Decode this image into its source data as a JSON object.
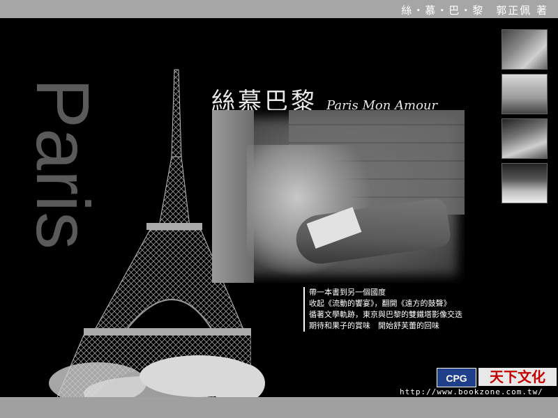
{
  "header": {
    "title": "絲・慕・巴・黎　郭正佩 著"
  },
  "side_word": "Paris",
  "heading": {
    "zh": "絲慕巴黎",
    "en": "Paris Mon Amour"
  },
  "caption": {
    "lines": [
      "帶一本書到另一個國度",
      "收起《流動的饗宴》，翻開《遠方的鼓聲》",
      "循著文學軌跡，東京與巴黎的雙鐵塔影像交迭",
      "期待和果子的賞味　開始舒芙蕾的回味"
    ]
  },
  "thumbnails": [
    {
      "icon": "street-scene-photo"
    },
    {
      "icon": "eiffel-tower-photo"
    },
    {
      "icon": "cafe-cat-photo"
    },
    {
      "icon": "pastry-plate-photo"
    }
  ],
  "logos": {
    "cpg": "CPG",
    "tianxia": "天下文化"
  },
  "url": "http://www.bookzone.com.tw/"
}
